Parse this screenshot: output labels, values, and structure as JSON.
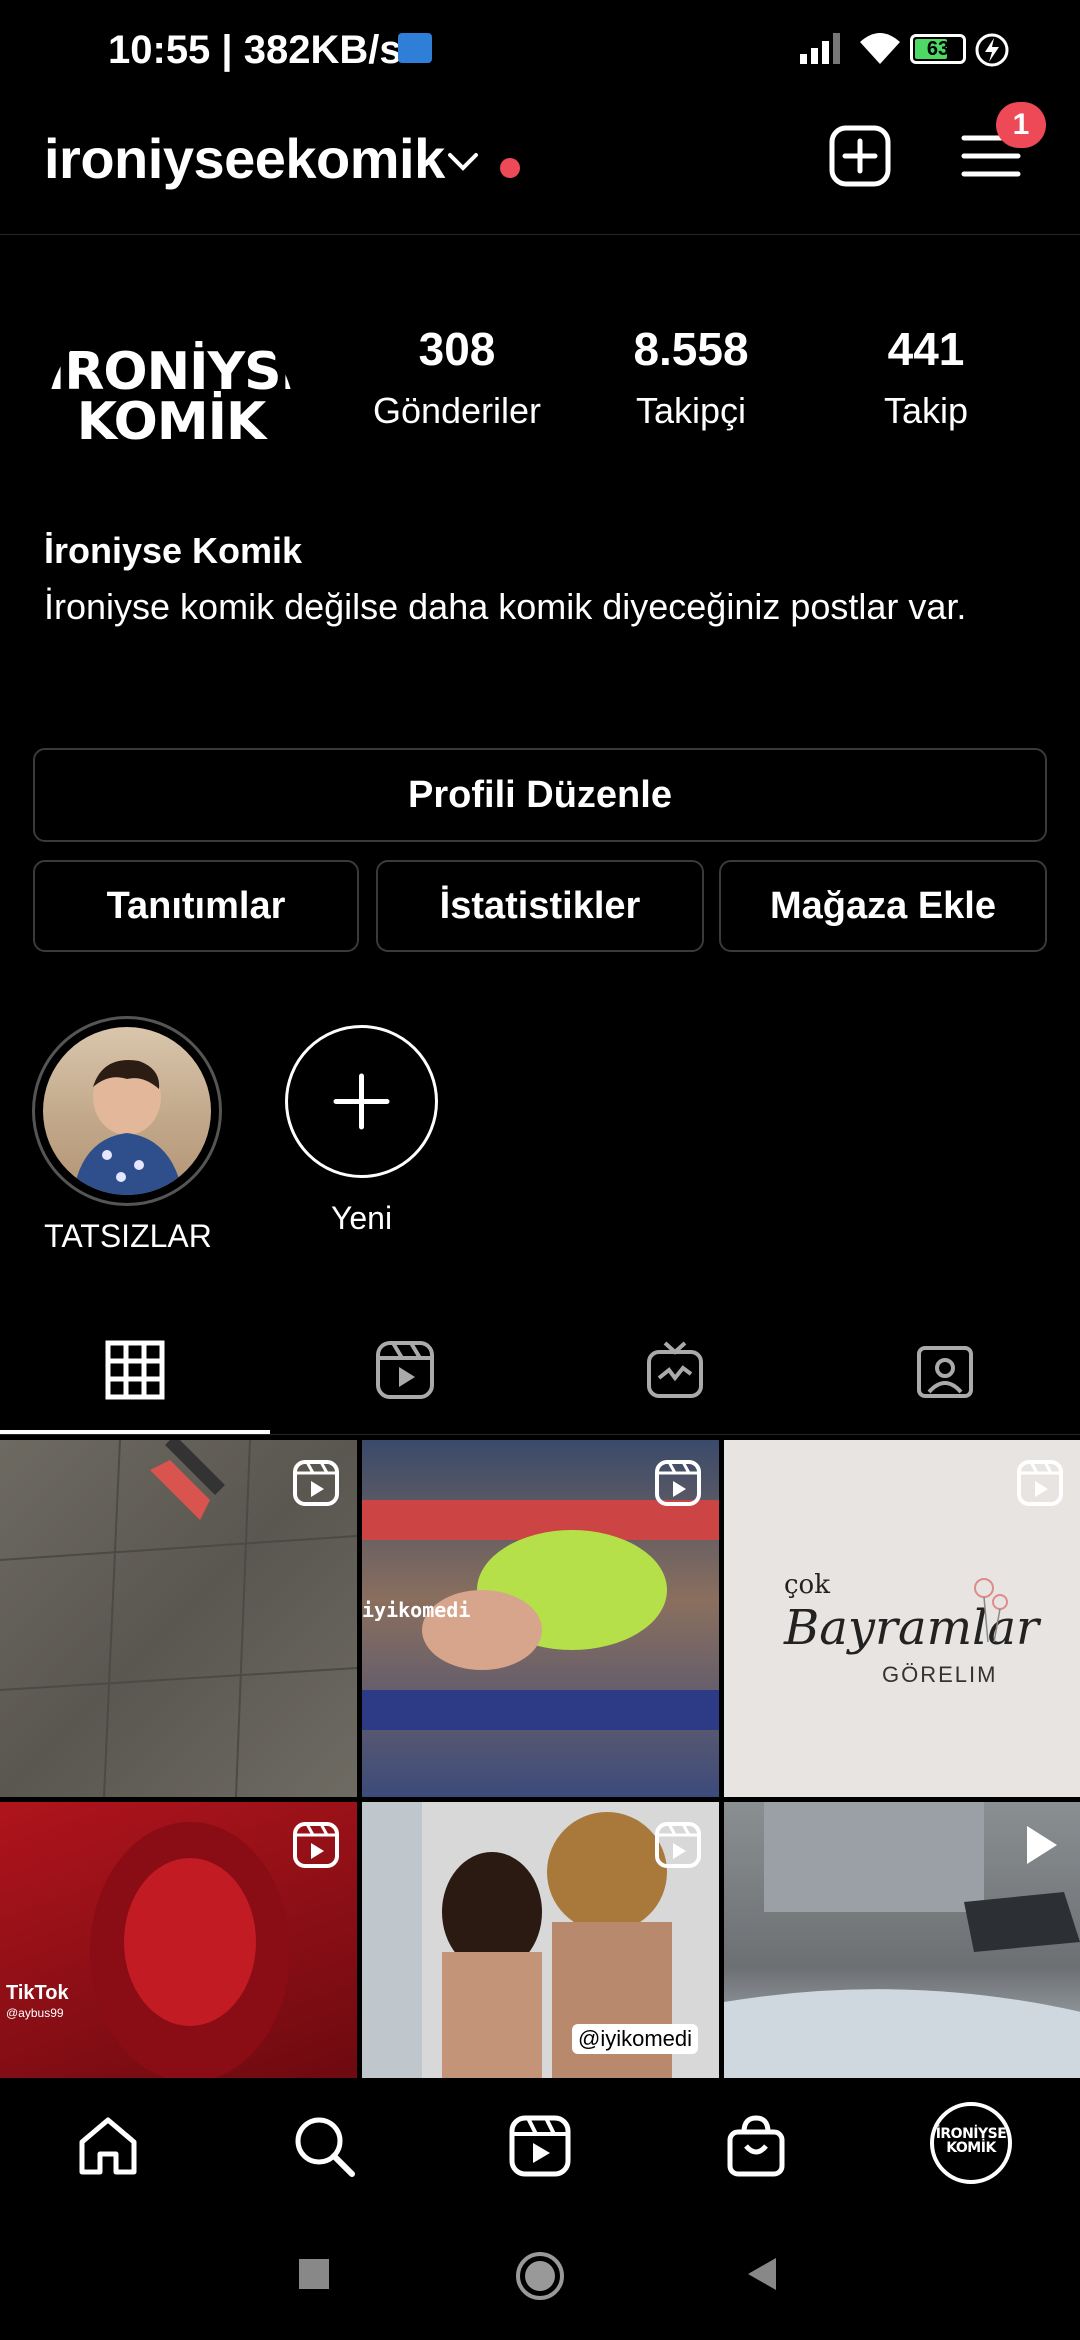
{
  "status_bar": {
    "time": "10:55 | 382KB/s",
    "battery": "63",
    "icons": [
      "network-activity-icon",
      "signal-icon",
      "wifi-icon",
      "battery-icon",
      "charging-icon"
    ]
  },
  "header": {
    "username": "ironiyseekomik",
    "menu_badge": "1",
    "icons": [
      "chevron-down-icon",
      "new-post-icon",
      "menu-icon"
    ],
    "accent": "#ed4956"
  },
  "profile": {
    "avatar_line1": "İRONİYSE",
    "avatar_line2": "KOMİK",
    "stats": [
      {
        "value": "308",
        "label": "Gönderiler"
      },
      {
        "value": "8.558",
        "label": "Takipçi"
      },
      {
        "value": "441",
        "label": "Takip"
      }
    ],
    "full_name": "İroniyse Komik",
    "bio": "İroniyse komik değilse daha komik diyeceğiniz postlar var."
  },
  "actions": {
    "edit_profile": "Profili Düzenle",
    "promotions": "Tanıtımlar",
    "insights": "İstatistikler",
    "add_shop": "Mağaza Ekle"
  },
  "highlights": [
    {
      "label": "TATSIZLAR"
    },
    {
      "label": "Yeni"
    }
  ],
  "tabs": [
    "grid-icon",
    "reels-icon",
    "igtv-icon",
    "tagged-icon"
  ],
  "grid": {
    "items": [
      {
        "caption": ""
      },
      {
        "caption": "iyikomedi"
      },
      {
        "caption_small": "çok",
        "caption_script": "Bayramlar",
        "caption_caps": "GÖRELIM"
      },
      {
        "caption": "TikTok",
        "caption_sub": "@aybus99"
      },
      {
        "caption": "@iyikomedi"
      },
      {
        "caption": ""
      }
    ]
  },
  "bottom_nav": [
    "home-icon",
    "search-icon",
    "reels-icon",
    "shop-icon",
    "profile-avatar"
  ],
  "bottom_nav_avatar": {
    "line1": "İRONİYSE",
    "line2": "KOMİK"
  }
}
